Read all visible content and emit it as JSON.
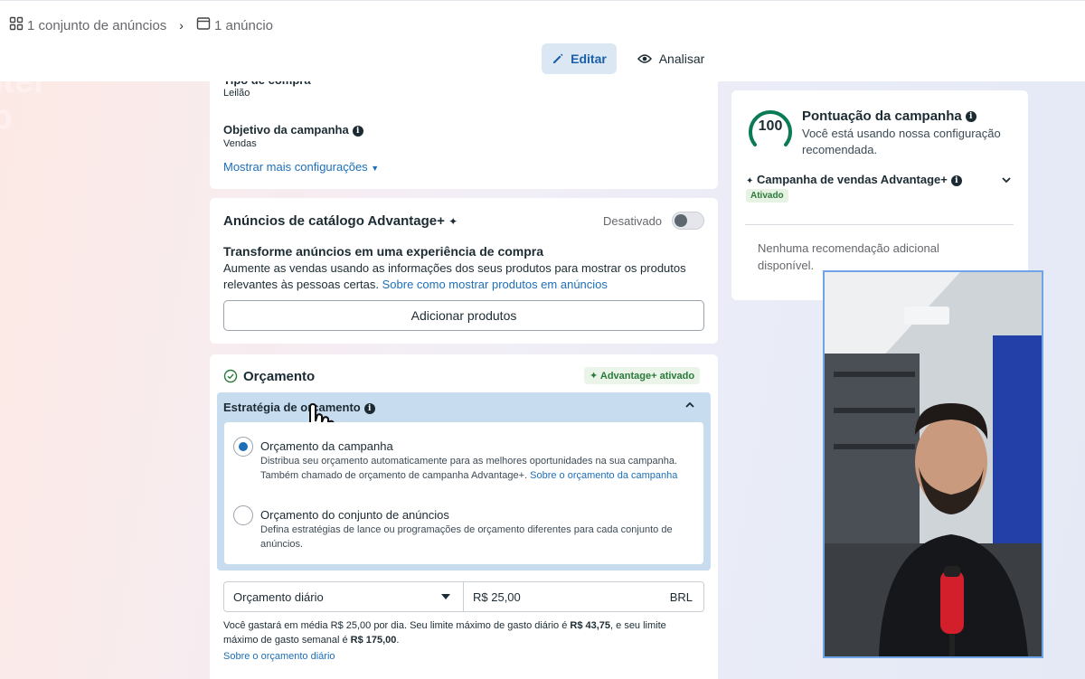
{
  "breadcrumb": {
    "adset": "1 conjunto de anúncios",
    "ad": "1 anúncio"
  },
  "header": {
    "edit_label": "Editar",
    "analyze_label": "Analisar"
  },
  "campaign_settings": {
    "purchase_type_label": "Tipo de compra",
    "purchase_type_value": "Leilão",
    "objective_label": "Objetivo da campanha",
    "objective_value": "Vendas",
    "more_settings_link": "Mostrar mais configurações"
  },
  "catalog_ads": {
    "title": "Anúncios de catálogo Advantage+",
    "toggle_state": "Desativado",
    "subtitle": "Transforme anúncios em uma experiência de compra",
    "description": "Aumente as vendas usando as informações dos seus produtos para mostrar os produtos relevantes às pessoas certas.",
    "learn_link": "Sobre como mostrar produtos em anúncios",
    "add_products_button": "Adicionar produtos"
  },
  "budget": {
    "title": "Orçamento",
    "advantage_badge": "Advantage+ ativado",
    "strategy_label": "Estratégia de orçamento",
    "options": [
      {
        "title": "Orçamento da campanha",
        "desc": "Distribua seu orçamento automaticamente para as melhores oportunidades na sua campanha. Também chamado de orçamento de campanha Advantage+.",
        "link": "Sobre o orçamento da campanha",
        "checked": true
      },
      {
        "title": "Orçamento do conjunto de anúncios",
        "desc": "Defina estratégias de lance ou programações de orçamento diferentes para cada conjunto de anúncios.",
        "checked": false
      }
    ],
    "budget_type": "Orçamento diário",
    "amount": "R$ 25,00",
    "currency": "BRL",
    "summary_pre": "Você gastará em média R$ 25,00 por dia. Seu limite máximo de gasto diário é ",
    "daily_max": "R$ 43,75",
    "summary_mid": ", e seu limite máximo de gasto semanal é ",
    "weekly_max": "R$ 175,00",
    "summary_end": ".",
    "daily_link": "Sobre o orçamento diário"
  },
  "score": {
    "value": "100",
    "progress": 1.0,
    "title": "Pontuação da campanha",
    "desc": "Você está usando nossa configuração recomendada.",
    "advantage_campaign": "Campanha de vendas Advantage+",
    "active_badge": "Ativado",
    "no_recommendations": "Nenhuma recomendação adicional disponível."
  },
  "colors": {
    "accent": "#1d6fb8",
    "score_green": "#0a7b55",
    "panel_blue": "#c8dcf0"
  }
}
